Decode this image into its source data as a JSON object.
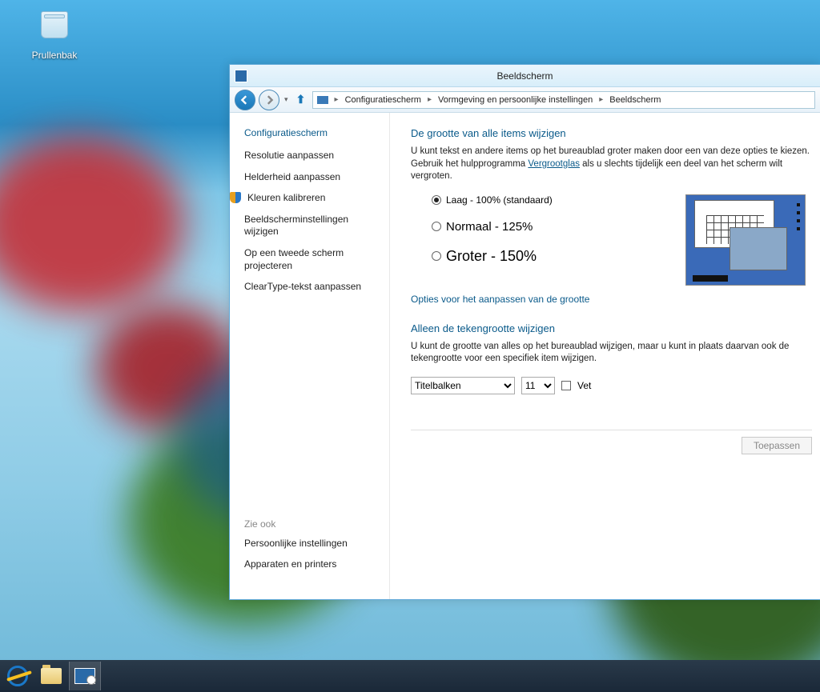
{
  "desktop": {
    "recycle_bin_label": "Prullenbak"
  },
  "window": {
    "title": "Beeldscherm"
  },
  "breadcrumb": {
    "items": [
      "Configuratiescherm",
      "Vormgeving en persoonlijke instellingen",
      "Beeldscherm"
    ]
  },
  "sidebar": {
    "home": "Configuratiescherm",
    "links": [
      "Resolutie aanpassen",
      "Helderheid aanpassen",
      "Kleuren kalibreren",
      "Beeldscherminstellingen wijzigen",
      "Op een tweede scherm projecteren",
      "ClearType-tekst aanpassen"
    ],
    "see_also_heading": "Zie ook",
    "see_also": [
      "Persoonlijke instellingen",
      "Apparaten en printers"
    ]
  },
  "main": {
    "sectionA_title": "De grootte van alle items wijzigen",
    "sectionA_text_before": "U kunt tekst en andere items op het bureaublad groter maken door een van deze opties te kiezen. Gebruik het hulpprogramma ",
    "sectionA_link": "Vergrootglas",
    "sectionA_text_after": " als u slechts tijdelijk een deel van het scherm wilt vergroten.",
    "radios": [
      {
        "label": "Laag - 100% (standaard)",
        "checked": true
      },
      {
        "label": "Normaal - 125%",
        "checked": false
      },
      {
        "label": "Groter - 150%",
        "checked": false
      }
    ],
    "options_link": "Opties voor het aanpassen van de grootte",
    "sectionB_title": "Alleen de tekengrootte wijzigen",
    "sectionB_text": "U kunt de grootte van alles op het bureaublad wijzigen, maar u kunt in plaats daarvan ook de tekengrootte voor een specifiek item wijzigen.",
    "select_item": "Titelbalken",
    "select_size": "11",
    "bold_label": "Vet",
    "apply_label": "Toepassen"
  }
}
